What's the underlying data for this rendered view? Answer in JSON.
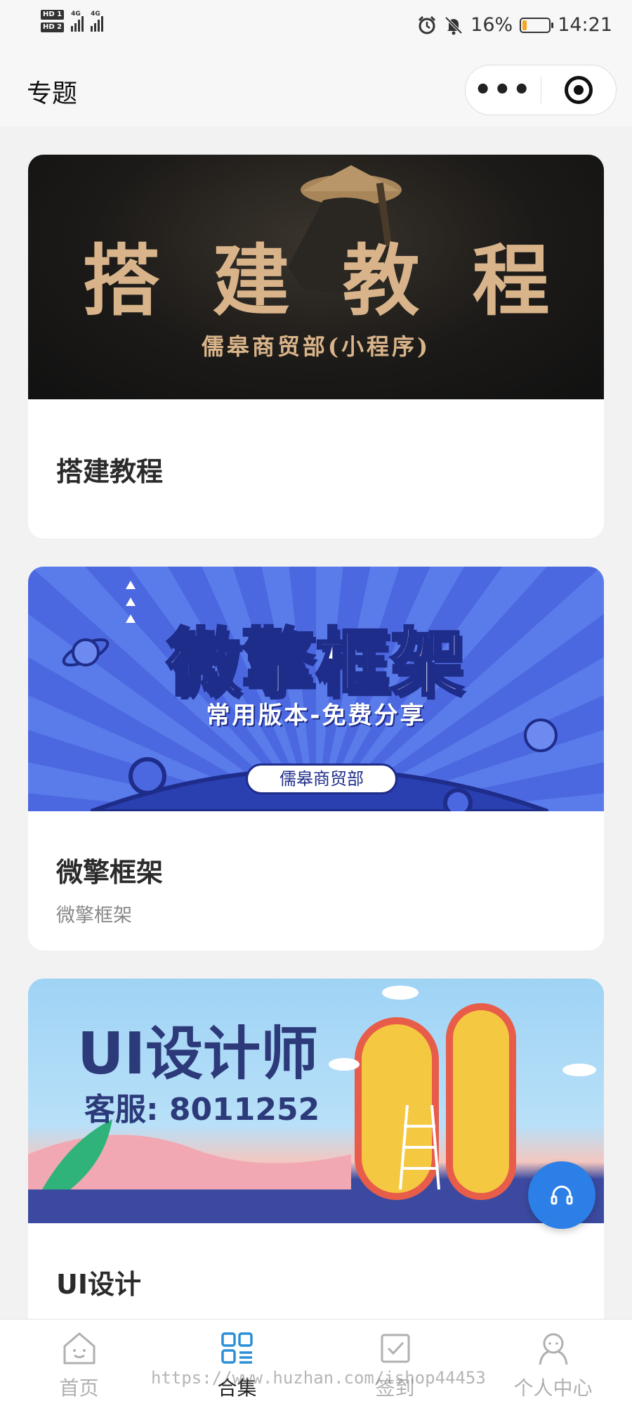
{
  "status_bar": {
    "hd1": "HD 1",
    "hd2": "HD 2",
    "net1": "4G",
    "net2": "4G",
    "battery_percent": "16%",
    "battery_level": 0.16,
    "time": "14:21"
  },
  "navbar": {
    "title": "专题",
    "more_label": "•••"
  },
  "cards": [
    {
      "banner_title_chars": [
        "搭",
        "建",
        "教",
        "程"
      ],
      "banner_subtitle": "儒皋商贸部(小程序)",
      "title": "搭建教程",
      "subtitle": ""
    },
    {
      "banner_title": "微擎框架",
      "banner_subtitle": "常用版本-免费分享",
      "banner_tag": "儒皋商贸部",
      "title": "微擎框架",
      "subtitle": "微擎框架"
    },
    {
      "banner_title": "UI设计师",
      "banner_subtitle": "客服: 8011252",
      "banner_letters": "UI",
      "title": "UI设计",
      "subtitle": ""
    }
  ],
  "tabbar": {
    "tabs": [
      {
        "label": "首页",
        "icon": "home-icon",
        "active": false
      },
      {
        "label": "合集",
        "icon": "collection-icon",
        "active": true
      },
      {
        "label": "签到",
        "icon": "checkin-icon",
        "active": false
      },
      {
        "label": "个人中心",
        "icon": "profile-icon",
        "active": false
      }
    ]
  },
  "watermark": "https://www.huzhan.com/ishop44453",
  "colors": {
    "accent": "#2b7fe6",
    "active_tab_icon": "#2b8fd6",
    "inactive": "#b0b0b0",
    "banner1_gold": "#d9b48a",
    "banner2_blue": "#4c68e0"
  }
}
